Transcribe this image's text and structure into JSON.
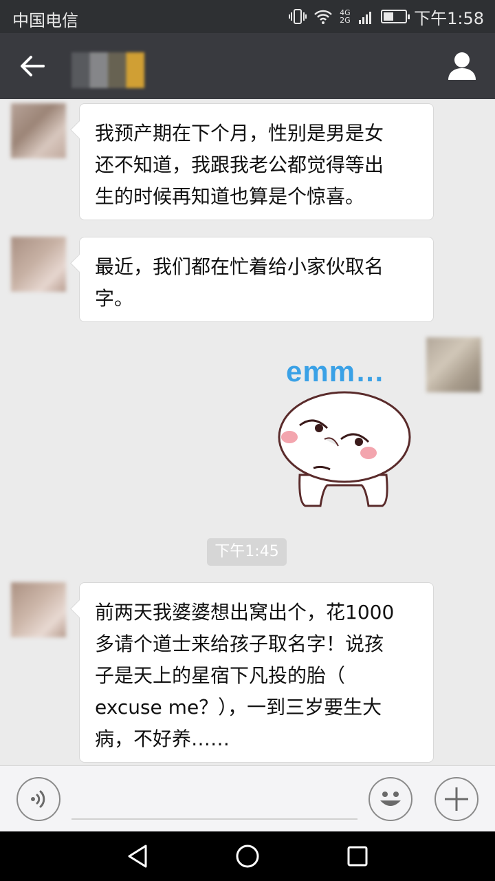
{
  "status_bar": {
    "carrier": "中国电信",
    "network": [
      "4G",
      "2G"
    ],
    "time": "下午1:58"
  },
  "title_bar": {
    "back_icon": "arrow-left-icon",
    "profile_icon": "person-icon"
  },
  "messages": [
    {
      "side": "left",
      "text_lines": [
        "我预产期在下个月，性别是男是女",
        "还不知道，我跟我老公都觉得等出",
        "生的时候再知道也算是个惊喜。"
      ]
    },
    {
      "side": "left",
      "text_lines": [
        "最近，我们都在忙着给小家伙取名",
        "字。"
      ]
    },
    {
      "side": "right",
      "type": "sticker",
      "sticker_text": "emm…"
    },
    {
      "type": "timestamp",
      "text": "下午1:45"
    },
    {
      "side": "left",
      "text_lines": [
        "前两天我婆婆想出窝出个，花1000",
        "多请个道士来给孩子取名字！说孩",
        "子是天上的星宿下凡投的胎（",
        "excuse me？），一到三岁要生大",
        "病，不好养……"
      ]
    }
  ],
  "input_bar": {
    "voice_icon": "voice-icon",
    "emoji_icon": "emoji-icon",
    "plus_icon": "plus-icon",
    "input_value": ""
  },
  "nav_bar": {
    "back_icon": "nav-back-icon",
    "home_icon": "nav-home-icon",
    "recents_icon": "nav-recents-icon"
  }
}
